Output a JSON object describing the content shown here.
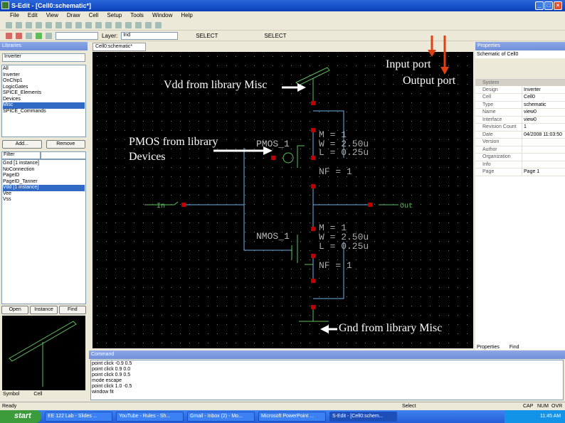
{
  "window": {
    "title": "S-Edit - [Cell0:schematic*]"
  },
  "menu": [
    "File",
    "Edit",
    "View",
    "Draw",
    "Cell",
    "Setup",
    "Tools",
    "Window",
    "Help"
  ],
  "toolbar": {
    "layer_label": "Layer:",
    "layer_value": "Ind",
    "select1": "SELECT",
    "select2": "SELECT"
  },
  "libraries": {
    "title": "Libraries",
    "dropdown": "Inverter",
    "items": [
      "All",
      "Inverter",
      "OnChip1",
      "LogicGates",
      "SPICE_Elements",
      "Devices",
      "Misc",
      "SPICE_Commands"
    ],
    "selected": 6,
    "add": "Add...",
    "remove": "Remove",
    "filter": "Filter",
    "cells": [
      "Gnd [1 instance]",
      "NoConnection",
      "PageID",
      "PageID_Tanner",
      "Vdd [1 instance]",
      "Vee",
      "Vss"
    ],
    "cell_selected": 4,
    "open": "Open",
    "instance": "Instance",
    "find": "Find",
    "preview_tabs": [
      "Symbol",
      "Cell"
    ]
  },
  "doc_tab": "Cell0:schematic*",
  "schematic": {
    "pmos_name": "PMOS_1",
    "nmos_name": "NMOS_1",
    "pmos_params": [
      "M = 1",
      "W = 2.50u",
      "L = 0.25u",
      "NF = 1"
    ],
    "nmos_params": [
      "M = 1",
      "W = 2.50u",
      "L = 0.25u",
      "NF = 1"
    ],
    "in_label": "In",
    "out_label": "Out"
  },
  "annotations": {
    "vdd": "Vdd from library Misc",
    "pmos": "PMOS from library Devices",
    "input": "Input port",
    "output": "Output port",
    "gnd": "Gnd from library Misc"
  },
  "properties": {
    "title": "Properties",
    "subtitle": "Schematic of Cell0",
    "section": "System",
    "rows": [
      [
        "Design",
        "Inverter"
      ],
      [
        "Cell",
        "Cell0"
      ],
      [
        "Type",
        "schematic"
      ],
      [
        "Name",
        "view0"
      ],
      [
        "Interface",
        "view0"
      ],
      [
        "Revision Count",
        "1"
      ],
      [
        "Date",
        "04/2008 11:03:50"
      ],
      [
        "Version",
        ""
      ],
      [
        "Author",
        ""
      ],
      [
        "Organization",
        ""
      ],
      [
        "Info",
        ""
      ],
      [
        "Page",
        "Page 1"
      ]
    ],
    "tabs": [
      "Properties",
      "Find"
    ]
  },
  "command": {
    "title": "Command",
    "lines": [
      "point click -0.9 0.5",
      "point click 0.9 0.0",
      "point click 0.9 0.5",
      "mode escape",
      "point click 1.0 -0.5",
      "window fit"
    ]
  },
  "status": {
    "left": "Ready",
    "mid": "Select",
    "caps": "CAP",
    "num": "NUM",
    "ovr": "OVR"
  },
  "taskbar": {
    "start": "start",
    "tasks": [
      "EE 122 Lab - Slides ...",
      "YouTube - Rules - Sh...",
      "Gmail - Inbox (2) - Mo...",
      "Microsoft PowerPoint ...",
      "S-Edit - [Cell0:schem..."
    ],
    "clock": "11:45 AM"
  },
  "colors": {
    "wire": "#6fb0e8",
    "port_green": "#5fbf5f",
    "node": "#c00000",
    "arrow_red": "#e04010"
  }
}
